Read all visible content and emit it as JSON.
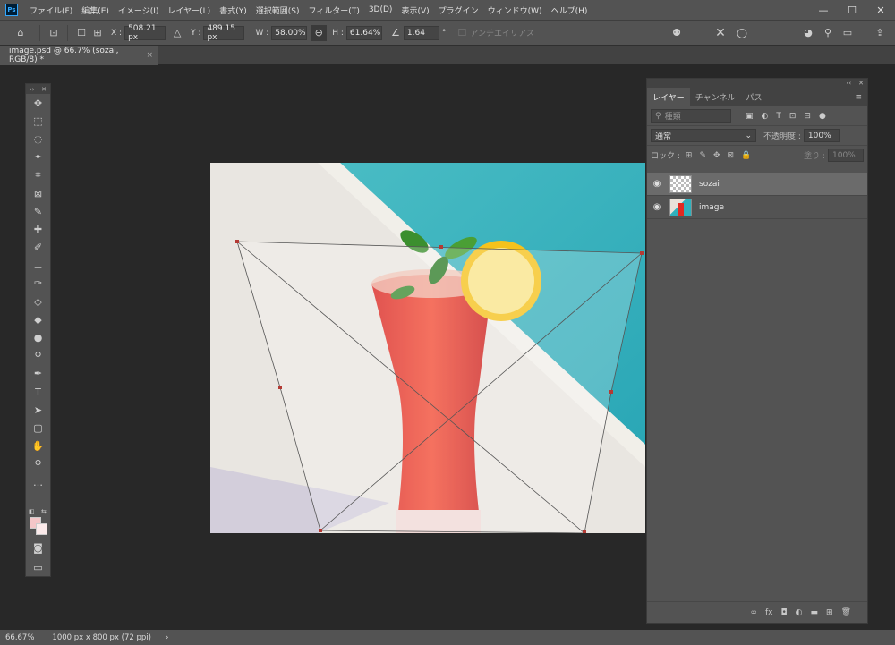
{
  "app": {
    "logo": "Ps"
  },
  "menu": [
    "ファイル(F)",
    "編集(E)",
    "イメージ(I)",
    "レイヤー(L)",
    "書式(Y)",
    "選択範囲(S)",
    "フィルター(T)",
    "3D(D)",
    "表示(V)",
    "プラグイン",
    "ウィンドウ(W)",
    "ヘルプ(H)"
  ],
  "window_controls": {
    "minimize": "—",
    "maximize": "☐",
    "close": "✕"
  },
  "options": {
    "x_label": "X :",
    "x_value": "508.21 px",
    "y_label": "Y :",
    "y_value": "489.15 px",
    "w_label": "W :",
    "w_value": "58.00%",
    "h_label": "H :",
    "h_value": "61.64%",
    "angle_value": "1.64",
    "angle_unit": "°",
    "antialias_label": "アンチエイリアス",
    "cancel_icon": "✕",
    "commit_icon": "○"
  },
  "document_tab": {
    "title": "image.psd @ 66.7% (sozai, RGB/8) *",
    "close": "×"
  },
  "toolbar": {
    "tools": [
      "move-tool",
      "marquee-tool",
      "lasso-tool",
      "magic-wand-tool",
      "crop-tool",
      "frame-tool",
      "eyedropper-tool",
      "healing-tool",
      "brush-tool",
      "stamp-tool",
      "history-brush-tool",
      "eraser-tool",
      "paint-bucket-tool",
      "blur-tool",
      "dodge-tool",
      "pen-tool",
      "type-tool",
      "path-select-tool",
      "shape-tool",
      "hand-tool",
      "zoom-tool",
      "more-tools"
    ],
    "glyphs": [
      "✥",
      "⬚",
      "◌",
      "✦",
      "⌗",
      "⊠",
      "✎",
      "✚",
      "✐",
      "⊥",
      "✑",
      "◇",
      "◆",
      "●",
      "⚲",
      "✒",
      "T",
      "➤",
      "▢",
      "✋",
      "⚲",
      "…"
    ],
    "colors": {
      "foreground": "#f4c6c8",
      "background": "#fbeaea"
    }
  },
  "layers_panel": {
    "tabs": [
      "レイヤー",
      "チャンネル",
      "パス"
    ],
    "filter_label": "種類",
    "blend_mode": "通常",
    "opacity_label": "不透明度 :",
    "opacity_value": "100%",
    "lock_label": "ロック :",
    "fill_label": "塗り :",
    "fill_value": "100%",
    "layers": [
      {
        "name": "sozai",
        "visible": true,
        "selected": true
      },
      {
        "name": "image",
        "visible": true,
        "selected": false
      }
    ],
    "footer_icons": [
      "link-icon",
      "fx-icon",
      "mask-icon",
      "adjustment-icon",
      "folder-icon",
      "new-layer-icon",
      "trash-icon"
    ],
    "footer_glyphs": [
      "∞",
      "fx",
      "◘",
      "◐",
      "▬",
      "⊞",
      "🗑"
    ]
  },
  "status": {
    "zoom": "66.67%",
    "doc_size": "1000 px x 800 px (72 ppi)",
    "arrow": "›"
  }
}
